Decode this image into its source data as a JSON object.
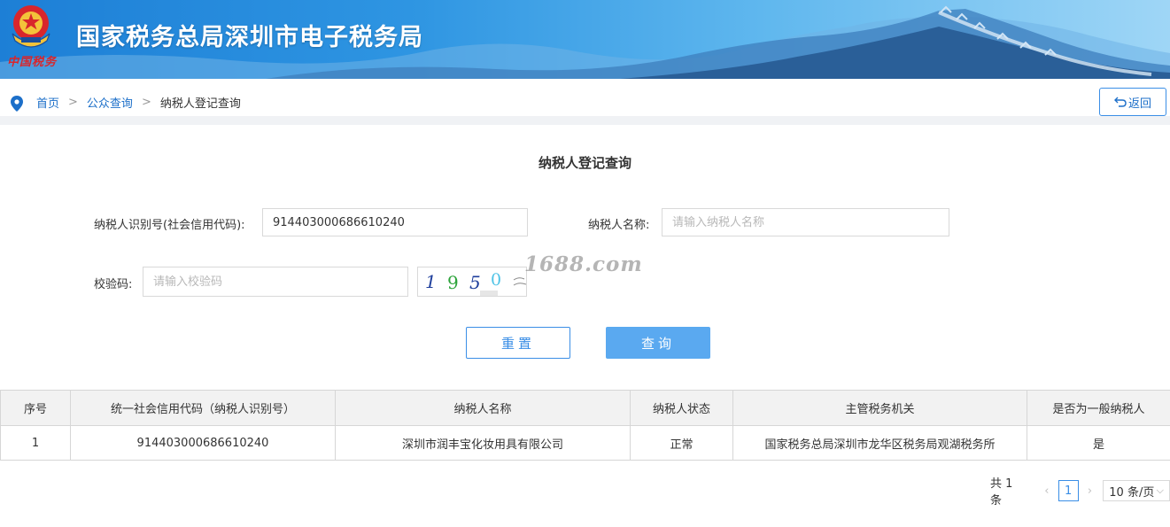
{
  "header": {
    "title": "国家税务总局深圳市电子税务局",
    "seal_text": "中国税务"
  },
  "breadcrumb": {
    "home": "首页",
    "public_query": "公众查询",
    "current": "纳税人登记查询",
    "separator": ">"
  },
  "back_button": {
    "label": "返回",
    "icon": "undo-icon"
  },
  "form": {
    "title": "纳税人登记查询",
    "taxpayer_id": {
      "label": "纳税人识别号(社会信用代码):",
      "value": "914403000686610240"
    },
    "taxpayer_name": {
      "label": "纳税人名称:",
      "placeholder": "请输入纳税人名称",
      "value": ""
    },
    "captcha_input": {
      "label": "校验码:",
      "placeholder": "请输入校验码",
      "value": ""
    },
    "captcha_chars": [
      "1",
      "9",
      "5",
      "0"
    ],
    "watermark": "1688.com",
    "reset_label": "重置",
    "query_label": "查询"
  },
  "table": {
    "columns": [
      "序号",
      "统一社会信用代码（纳税人识别号）",
      "纳税人名称",
      "纳税人状态",
      "主管税务机关",
      "是否为一般纳税人"
    ],
    "rows": [
      [
        "1",
        "914403000686610240",
        "深圳市润丰宝化妆用具有限公司",
        "正常",
        "国家税务总局深圳市龙华区税务局观湖税务所",
        "是"
      ]
    ]
  },
  "pagination": {
    "total": "共 1 条",
    "current_page": "1",
    "page_size": "10 条/页"
  },
  "colors": {
    "accent": "#3a8ee6",
    "link": "#1c6fc9",
    "query_button": "#5aa9f0",
    "seal_red": "#d8262c"
  }
}
